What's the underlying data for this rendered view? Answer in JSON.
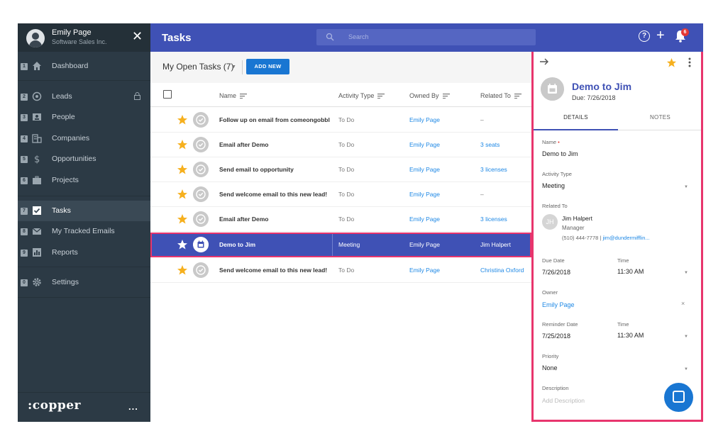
{
  "user": {
    "name": "Emily Page",
    "org": "Software Sales Inc."
  },
  "sidebar": {
    "items": [
      {
        "num": "1",
        "label": "Dashboard",
        "icon": "home-icon"
      },
      {
        "num": "2",
        "label": "Leads",
        "icon": "target-icon",
        "locked": true
      },
      {
        "num": "3",
        "label": "People",
        "icon": "contact-card-icon"
      },
      {
        "num": "4",
        "label": "Companies",
        "icon": "building-icon"
      },
      {
        "num": "5",
        "label": "Opportunities",
        "icon": "dollar-icon"
      },
      {
        "num": "6",
        "label": "Projects",
        "icon": "briefcase-icon"
      },
      {
        "num": "7",
        "label": "Tasks",
        "icon": "checkbox-icon",
        "active": true
      },
      {
        "num": "8",
        "label": "My Tracked Emails",
        "icon": "mail-icon"
      },
      {
        "num": "9",
        "label": "Reports",
        "icon": "bar-chart-icon"
      },
      {
        "num": "0",
        "label": "Settings",
        "icon": "gear-icon"
      }
    ],
    "logo": ":copper",
    "more": "..."
  },
  "header": {
    "title": "Tasks",
    "search_placeholder": "Search",
    "help": "?",
    "plus": "+",
    "notification_count": "6"
  },
  "toolbar": {
    "view": "My Open Tasks (7)",
    "add_new": "ADD NEW"
  },
  "table": {
    "columns": [
      "Name",
      "Activity Type",
      "Owned By",
      "Related To"
    ],
    "rows": [
      {
        "name": "Follow up on email from comeongobblu",
        "type": "To Do",
        "owner": "Emily Page",
        "related": "–"
      },
      {
        "name": "Email after Demo",
        "type": "To Do",
        "owner": "Emily Page",
        "related": "3 seats"
      },
      {
        "name": "Send email to opportunity",
        "type": "To Do",
        "owner": "Emily Page",
        "related": "3 licenses"
      },
      {
        "name": "Send welcome email to this new lead!",
        "type": "To Do",
        "owner": "Emily Page",
        "related": "–"
      },
      {
        "name": "Email after Demo",
        "type": "To Do",
        "owner": "Emily Page",
        "related": "3 licenses"
      },
      {
        "name": "Demo to Jim",
        "type": "Meeting",
        "owner": "Emily Page",
        "related": "Jim Halpert",
        "selected": true
      },
      {
        "name": "Send welcome email to this new lead!",
        "type": "To Do",
        "owner": "Emily Page",
        "related": "Christina Oxford"
      }
    ]
  },
  "panel": {
    "title": "Demo to Jim",
    "due": "Due: 7/26/2018",
    "tabs": [
      "DETAILS",
      "NOTES"
    ],
    "name_label": "Name",
    "name_required": "•",
    "name_value": "Demo to Jim",
    "activity_type_label": "Activity Type",
    "activity_type_value": "Meeting",
    "related_label": "Related To",
    "related_initials": "JH",
    "related_name": "Jim Halpert",
    "related_title": "Manager",
    "related_phone": "(510) 444-7778",
    "related_sep": "|",
    "related_email": "jim@dundermifflin...",
    "due_date_label": "Due Date",
    "due_date_value": "7/26/2018",
    "time_label": "Time",
    "due_time_value": "11:30 AM",
    "owner_label": "Owner",
    "owner_value": "Emily Page",
    "owner_clear": "×",
    "reminder_label": "Reminder Date",
    "reminder_value": "7/25/2018",
    "reminder_time_label": "Time",
    "reminder_time_value": "11:30 AM",
    "priority_label": "Priority",
    "priority_value": "None",
    "description_label": "Description",
    "description_placeholder": "Add Description"
  },
  "colors": {
    "primary": "#3f51b5",
    "sidebar": "#2c3a45",
    "highlight": "#e8356d",
    "star": "#f6b01e",
    "link": "#1e88e5"
  }
}
